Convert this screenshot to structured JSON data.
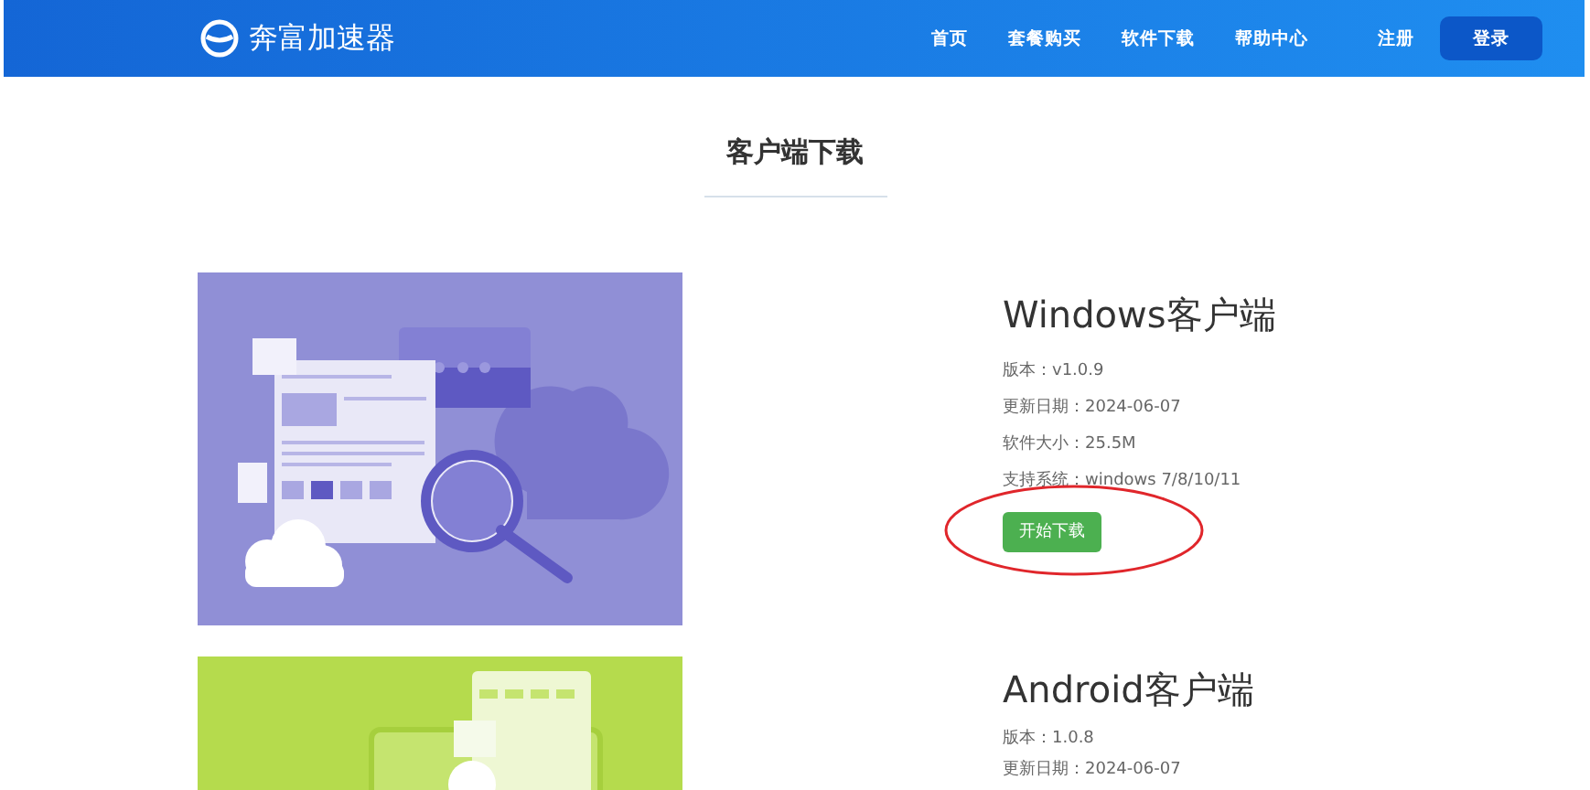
{
  "header": {
    "logo": "奔富加速器",
    "nav": [
      {
        "label": "首页"
      },
      {
        "label": "套餐购买"
      },
      {
        "label": "软件下载"
      },
      {
        "label": "帮助中心"
      }
    ],
    "register": "注册",
    "login": "登录"
  },
  "page_title": "客户端下载",
  "clients": [
    {
      "kind": "windows",
      "title": "Windows客户端",
      "details": [
        "版本：v1.0.9",
        "更新日期：2024-06-07",
        "软件大小：25.5M",
        "支持系统：windows 7/8/10/11"
      ],
      "button": "开始下载",
      "circled": true
    },
    {
      "kind": "android",
      "title": "Android客户端",
      "details": [
        "版本：1.0.8",
        "更新日期：2024-06-07"
      ]
    }
  ]
}
